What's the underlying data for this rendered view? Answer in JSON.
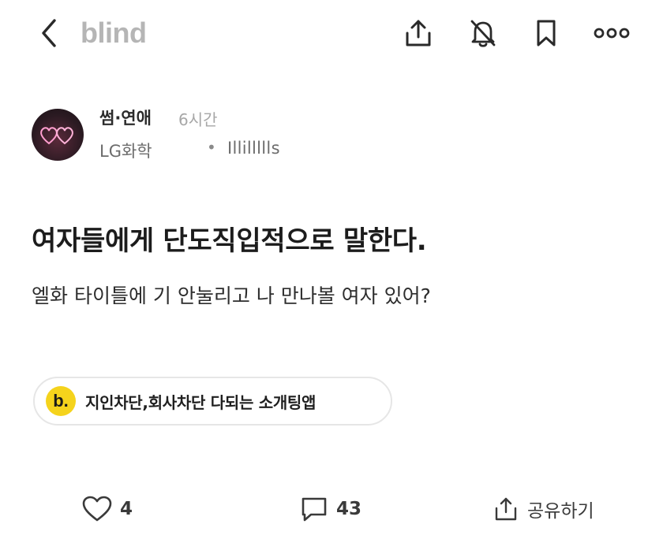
{
  "header": {
    "logo_text": "blind",
    "icons": [
      "back-icon",
      "share-icon",
      "bell-off-icon",
      "bookmark-icon",
      "more-icon"
    ]
  },
  "post": {
    "board": "썸·연애",
    "time_ago": "6시간",
    "company": "LG화학",
    "separator": "•",
    "nickname": "Illillllls",
    "title": "여자들에게 단도직입적으로 말한다.",
    "body": "엘화 타이틀에 기 안눌리고 나 만나볼 여자 있어?"
  },
  "ad": {
    "logo_letter": "b.",
    "text": "지인차단,회사차단 다되는 소개팅앱",
    "accent_color": "#f5d31c"
  },
  "actions": {
    "likes": "4",
    "comments": "43",
    "share_label": "공유하기"
  },
  "colors": {
    "logo_gray": "#b5b5b5",
    "text_dark": "#1c1c1c",
    "muted": "#a7a7a7"
  }
}
